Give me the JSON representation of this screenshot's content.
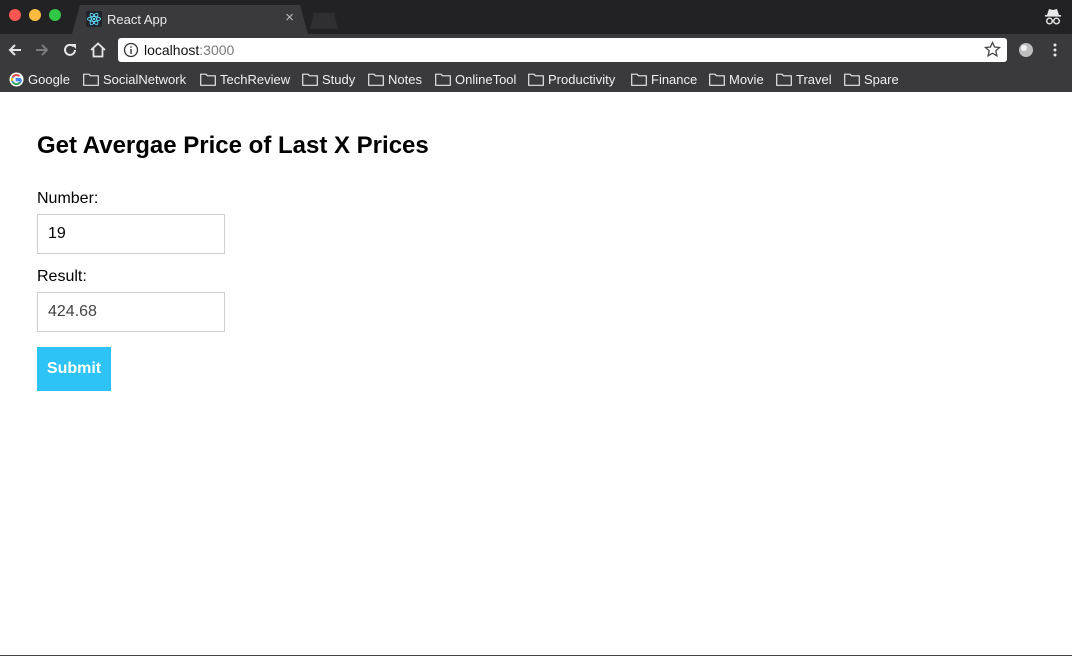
{
  "browser": {
    "tab": {
      "title": "React App",
      "close_glyph": "×",
      "favicon": "react-logo-icon"
    },
    "address": {
      "host": "localhost",
      "port": ":3000"
    },
    "bookmarks": [
      {
        "label": "Google",
        "icon": "google-icon"
      },
      {
        "label": "SocialNetwork",
        "icon": "folder-icon"
      },
      {
        "label": "TechReview",
        "icon": "folder-icon"
      },
      {
        "label": "Study",
        "icon": "folder-icon"
      },
      {
        "label": "Notes",
        "icon": "folder-icon"
      },
      {
        "label": "OnlineTool",
        "icon": "folder-icon"
      },
      {
        "label": "Productivity",
        "icon": "folder-icon"
      },
      {
        "label": "Finance",
        "icon": "folder-icon"
      },
      {
        "label": "Movie",
        "icon": "folder-icon"
      },
      {
        "label": "Travel",
        "icon": "folder-icon"
      },
      {
        "label": "Spare",
        "icon": "folder-icon"
      }
    ]
  },
  "form": {
    "heading": "Get Avergae Price of Last X Prices",
    "number_label": "Number:",
    "number_value": "19",
    "result_label": "Result:",
    "result_value": "424.68",
    "submit_label": "Submit"
  },
  "colors": {
    "chrome_dark": "#222224",
    "chrome_toolbar": "#3a3a3c",
    "submit_accent": "#2ec3f7"
  }
}
